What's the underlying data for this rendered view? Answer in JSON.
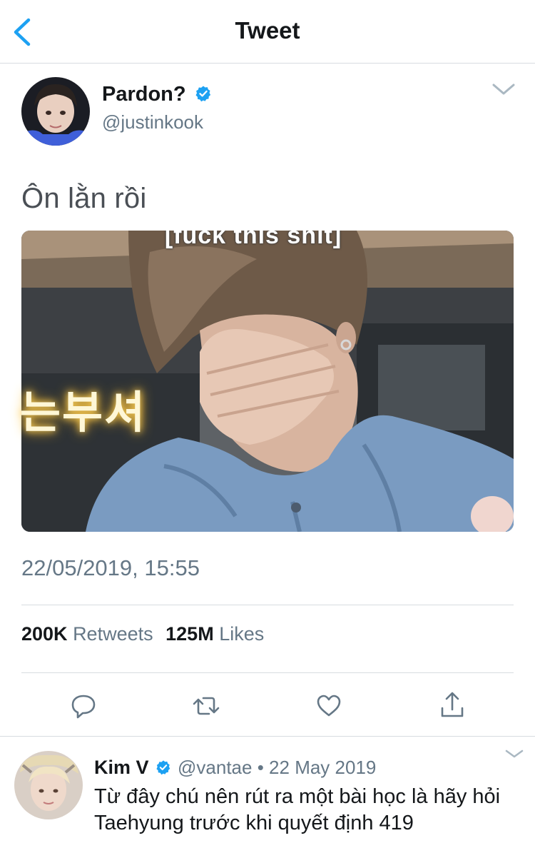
{
  "nav": {
    "title": "Tweet"
  },
  "tweet": {
    "author_name": "Pardon?",
    "author_handle": "@justinkook",
    "text": "Ôn lằn rồi",
    "media_caption": "[fuck this shit]",
    "media_overlay_text": "는부셔",
    "timestamp": "22/05/2019, 15:55",
    "retweets_count": "200K",
    "retweets_label": "Retweets",
    "likes_count": "125M",
    "likes_label": "Likes"
  },
  "actions": {
    "reply_icon": "reply-icon",
    "retweet_icon": "retweet-icon",
    "like_icon": "heart-icon",
    "share_icon": "share-icon"
  },
  "reply": {
    "author_name": "Kim V",
    "author_handle": "@vantae",
    "separator": "•",
    "date": "22 May 2019",
    "text": "Từ đây chú nên rút ra một bài học là hãy hỏi Taehyung trước khi quyết định 419"
  },
  "colors": {
    "accent": "#1da1f2",
    "secondary_text": "#657786",
    "divider": "#d7dce0"
  }
}
